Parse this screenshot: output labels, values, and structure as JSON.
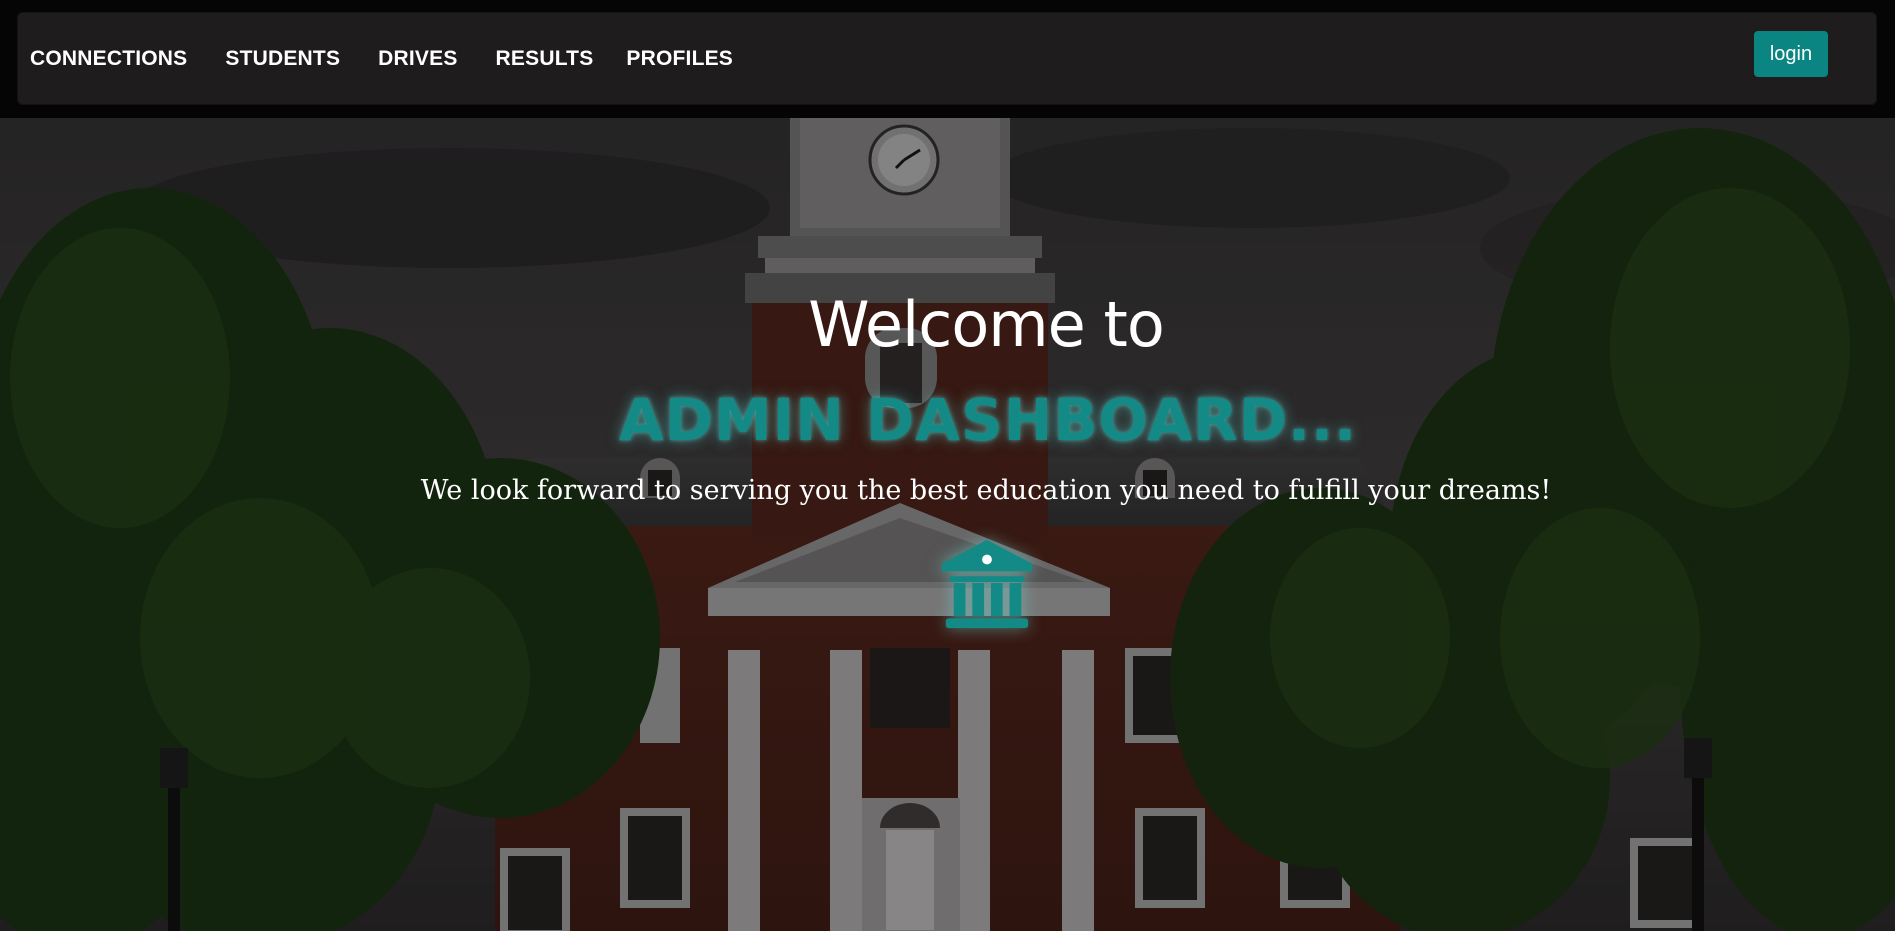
{
  "navbar": {
    "links": [
      {
        "label": "CONNECTIONS"
      },
      {
        "label": "STUDENTS"
      },
      {
        "label": "DRIVES"
      },
      {
        "label": "RESULTS"
      },
      {
        "label": "PROFILES"
      }
    ],
    "login_label": "login"
  },
  "hero": {
    "welcome": "Welcome to",
    "headline": "ADMIN DASHBOARD...",
    "tagline": "We look forward to serving you the best education you need to fulfill your dreams!",
    "icon": "institution-icon",
    "background": "campus-hall-photo"
  },
  "colors": {
    "accent": "#0b8582",
    "headline": "#148a87",
    "navbar_bg": "#1f1c1e",
    "page_bg": "#050505"
  }
}
